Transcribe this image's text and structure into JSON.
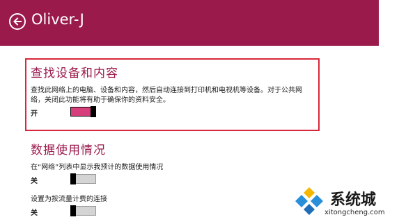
{
  "header": {
    "title": "Oliver-J",
    "back_icon": "back-arrow-circle-icon",
    "background": "#9b1a4c"
  },
  "find_devices": {
    "title": "查找设备和内容",
    "desc_line1": "查找此网络上的电脑、设备和内容，然后自动连接到打印机和电视机等设备。对于公共网",
    "desc_line2": "络，关闭此功能将有助于确保你的资料安全。",
    "state_label": "开",
    "toggle_on": true,
    "highlight_color": "#d8263b"
  },
  "data_usage": {
    "title": "数据使用情况",
    "setting1": {
      "desc": "在“网络”列表中显示我预计的数据使用情况",
      "state_label": "关",
      "toggle_on": false
    },
    "setting2": {
      "desc": "设置为按流量计费的连接",
      "state_label": "关",
      "toggle_on": false
    }
  },
  "watermark": {
    "name": "系统城",
    "url": "xitongcheng.com"
  },
  "colors": {
    "accent": "#9b1a4c",
    "toggle_on": "#d63f7c",
    "toggle_off": "#d4d4d4"
  }
}
